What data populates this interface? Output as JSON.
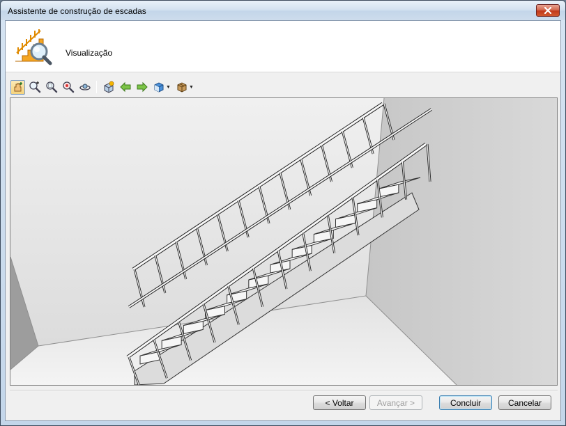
{
  "window": {
    "title": "Assistente de construção de escadas"
  },
  "header": {
    "title": "Visualização",
    "icon": "stair-magnifier-icon"
  },
  "toolbar": {
    "tools": [
      {
        "name": "pan-icon",
        "active": true
      },
      {
        "name": "zoom-in-icon"
      },
      {
        "name": "zoom-window-icon"
      },
      {
        "name": "zoom-extents-icon"
      },
      {
        "name": "orbit-icon"
      },
      {
        "name": "render-icon"
      },
      {
        "name": "arrow-left-icon"
      },
      {
        "name": "arrow-right-icon"
      },
      {
        "name": "view-cube-icon",
        "dropdown": true
      },
      {
        "name": "box-icon",
        "dropdown": true
      }
    ]
  },
  "buttons": {
    "back": "< Voltar",
    "next": "Avançar >",
    "finish": "Concluir",
    "cancel": "Cancelar"
  },
  "stair": {
    "steps": 12
  }
}
